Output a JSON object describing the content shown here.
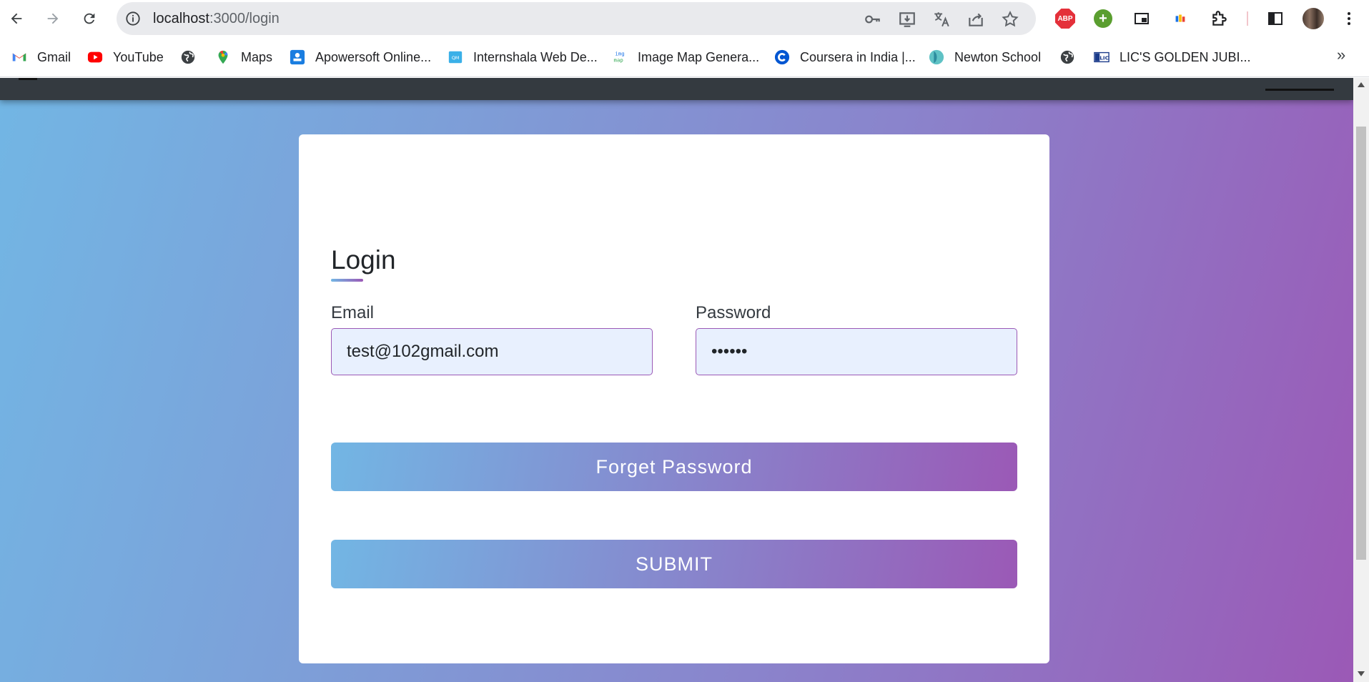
{
  "browser": {
    "url_host": "localhost",
    "url_path": ":3000/login",
    "abp_label": "ABP",
    "bookmarks": [
      {
        "label": "Gmail",
        "icon": "gmail-icon"
      },
      {
        "label": "YouTube",
        "icon": "youtube-icon"
      },
      {
        "label": "",
        "icon": "globe-icon"
      },
      {
        "label": "Maps",
        "icon": "maps-icon"
      },
      {
        "label": "Apowersoft Online...",
        "icon": "apowersoft-icon"
      },
      {
        "label": "Internshala Web De...",
        "icon": "internshala-icon"
      },
      {
        "label": "Image Map Genera...",
        "icon": "imagemap-icon"
      },
      {
        "label": "Coursera in India |...",
        "icon": "coursera-icon"
      },
      {
        "label": "Newton School",
        "icon": "newton-icon"
      },
      {
        "label": "",
        "icon": "globe-icon"
      },
      {
        "label": "LIC'S GOLDEN JUBI...",
        "icon": "lic-icon"
      }
    ],
    "more_bookmarks": "»"
  },
  "login": {
    "title": "Login",
    "email_label": "Email",
    "email_value": "test@102gmail.com",
    "password_label": "Password",
    "password_value": "••••••",
    "forget_button": "Forget Password",
    "submit_button": "SUBMIT"
  },
  "colors": {
    "gradient_start": "#72b6e4",
    "gradient_end": "#9b59b6",
    "header_bg": "#343a40",
    "input_bg": "#e8f0fe"
  }
}
